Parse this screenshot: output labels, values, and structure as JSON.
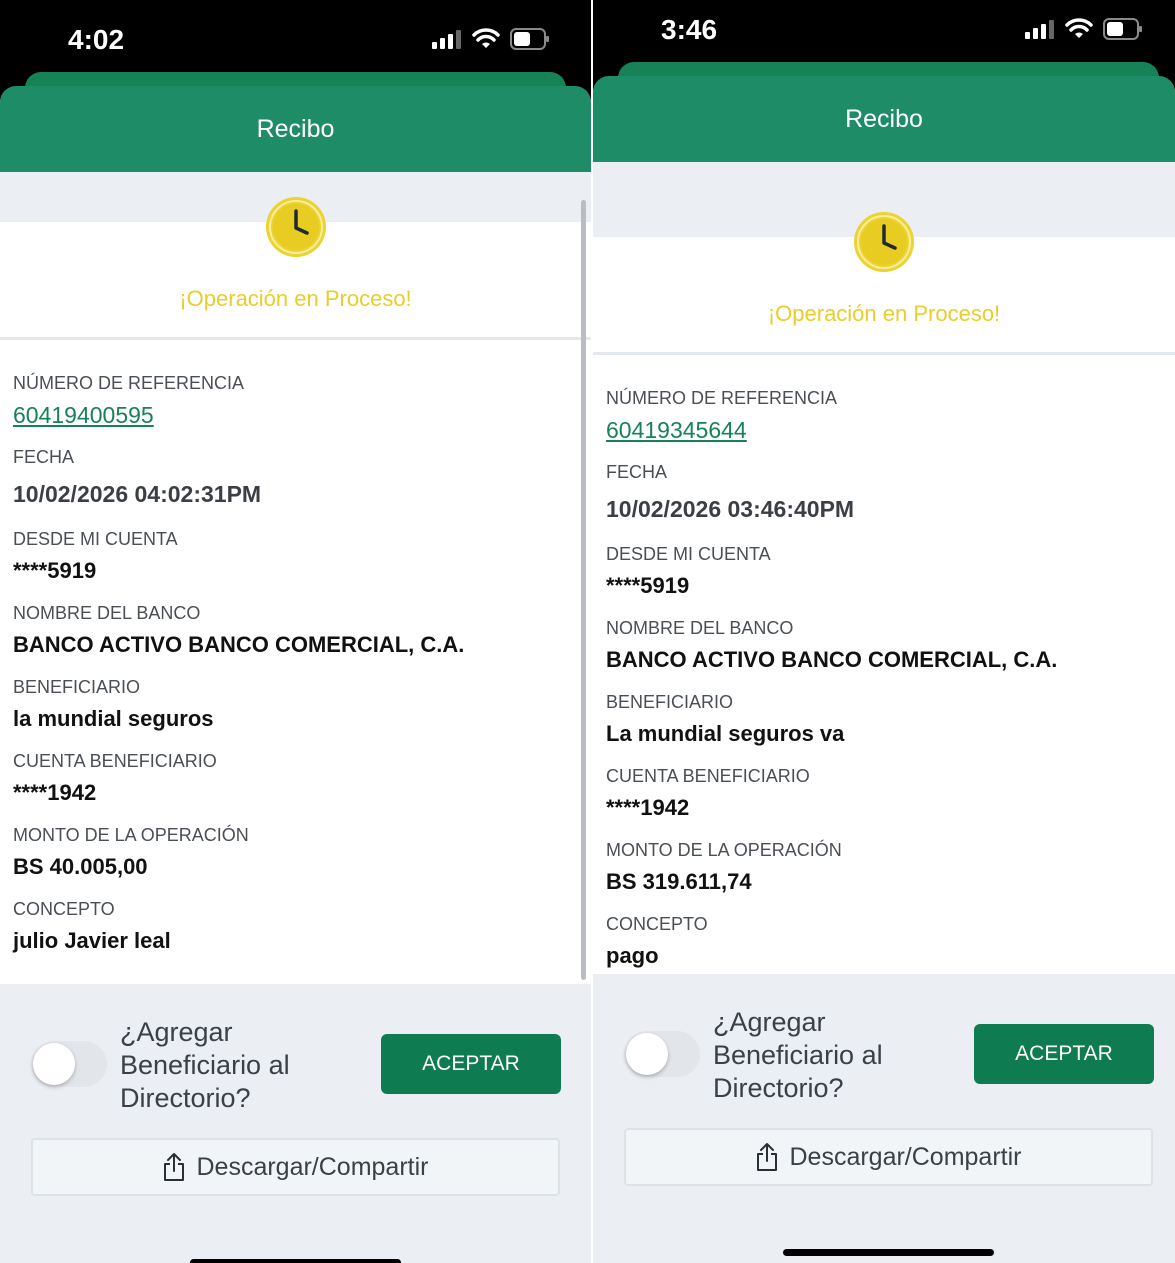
{
  "left": {
    "status_time": "4:02",
    "header_title": "Recibo",
    "status_text": "¡Operación en Proceso!",
    "fields": {
      "reference_label": "NÚMERO DE REFERENCIA",
      "reference_value": "60419400595",
      "date_label": "FECHA",
      "date_value": "10/02/2026 04:02:31PM",
      "from_label": "DESDE MI CUENTA",
      "from_value": "****5919",
      "bank_label": "NOMBRE DEL BANCO",
      "bank_value": "BANCO ACTIVO BANCO COMERCIAL, C.A.",
      "beneficiary_label": "BENEFICIARIO",
      "beneficiary_value": "la mundial seguros",
      "ben_account_label": "CUENTA BENEFICIARIO",
      "ben_account_value": "****1942",
      "amount_label": "MONTO DE LA OPERACIÓN",
      "amount_value": "BS 40.005,00",
      "concept_label": "CONCEPTO",
      "concept_value": "julio Javier leal"
    },
    "toggle_label": "¿Agregar Beneficiario al Directorio?",
    "toggle_on": false,
    "accept_label": "ACEPTAR",
    "share_label": "Descargar/Compartir"
  },
  "right": {
    "status_time": "3:46",
    "header_title": "Recibo",
    "status_text": "¡Operación en Proceso!",
    "fields": {
      "reference_label": "NÚMERO DE REFERENCIA",
      "reference_value": "60419345644",
      "date_label": "FECHA",
      "date_value": "10/02/2026 03:46:40PM",
      "from_label": "DESDE MI CUENTA",
      "from_value": "****5919",
      "bank_label": "NOMBRE DEL BANCO",
      "bank_value": "BANCO ACTIVO BANCO COMERCIAL, C.A.",
      "beneficiary_label": "BENEFICIARIO",
      "beneficiary_value": "La mundial seguros va",
      "ben_account_label": "CUENTA BENEFICIARIO",
      "ben_account_value": "****1942",
      "amount_label": "MONTO DE LA OPERACIÓN",
      "amount_value": "BS 319.611,74",
      "concept_label": "CONCEPTO",
      "concept_value": "pago"
    },
    "toggle_label": "¿Agregar Beneficiario al Directorio?",
    "toggle_on": false,
    "accept_label": "ACEPTAR",
    "share_label": "Descargar/Compartir"
  },
  "colors": {
    "header_green": "#1f8c68",
    "accent_green": "#0e7b51",
    "pending_yellow": "#e9cd2a"
  },
  "icons": [
    "signal-icon",
    "wifi-icon",
    "battery-icon",
    "clock-icon",
    "share-icon"
  ]
}
